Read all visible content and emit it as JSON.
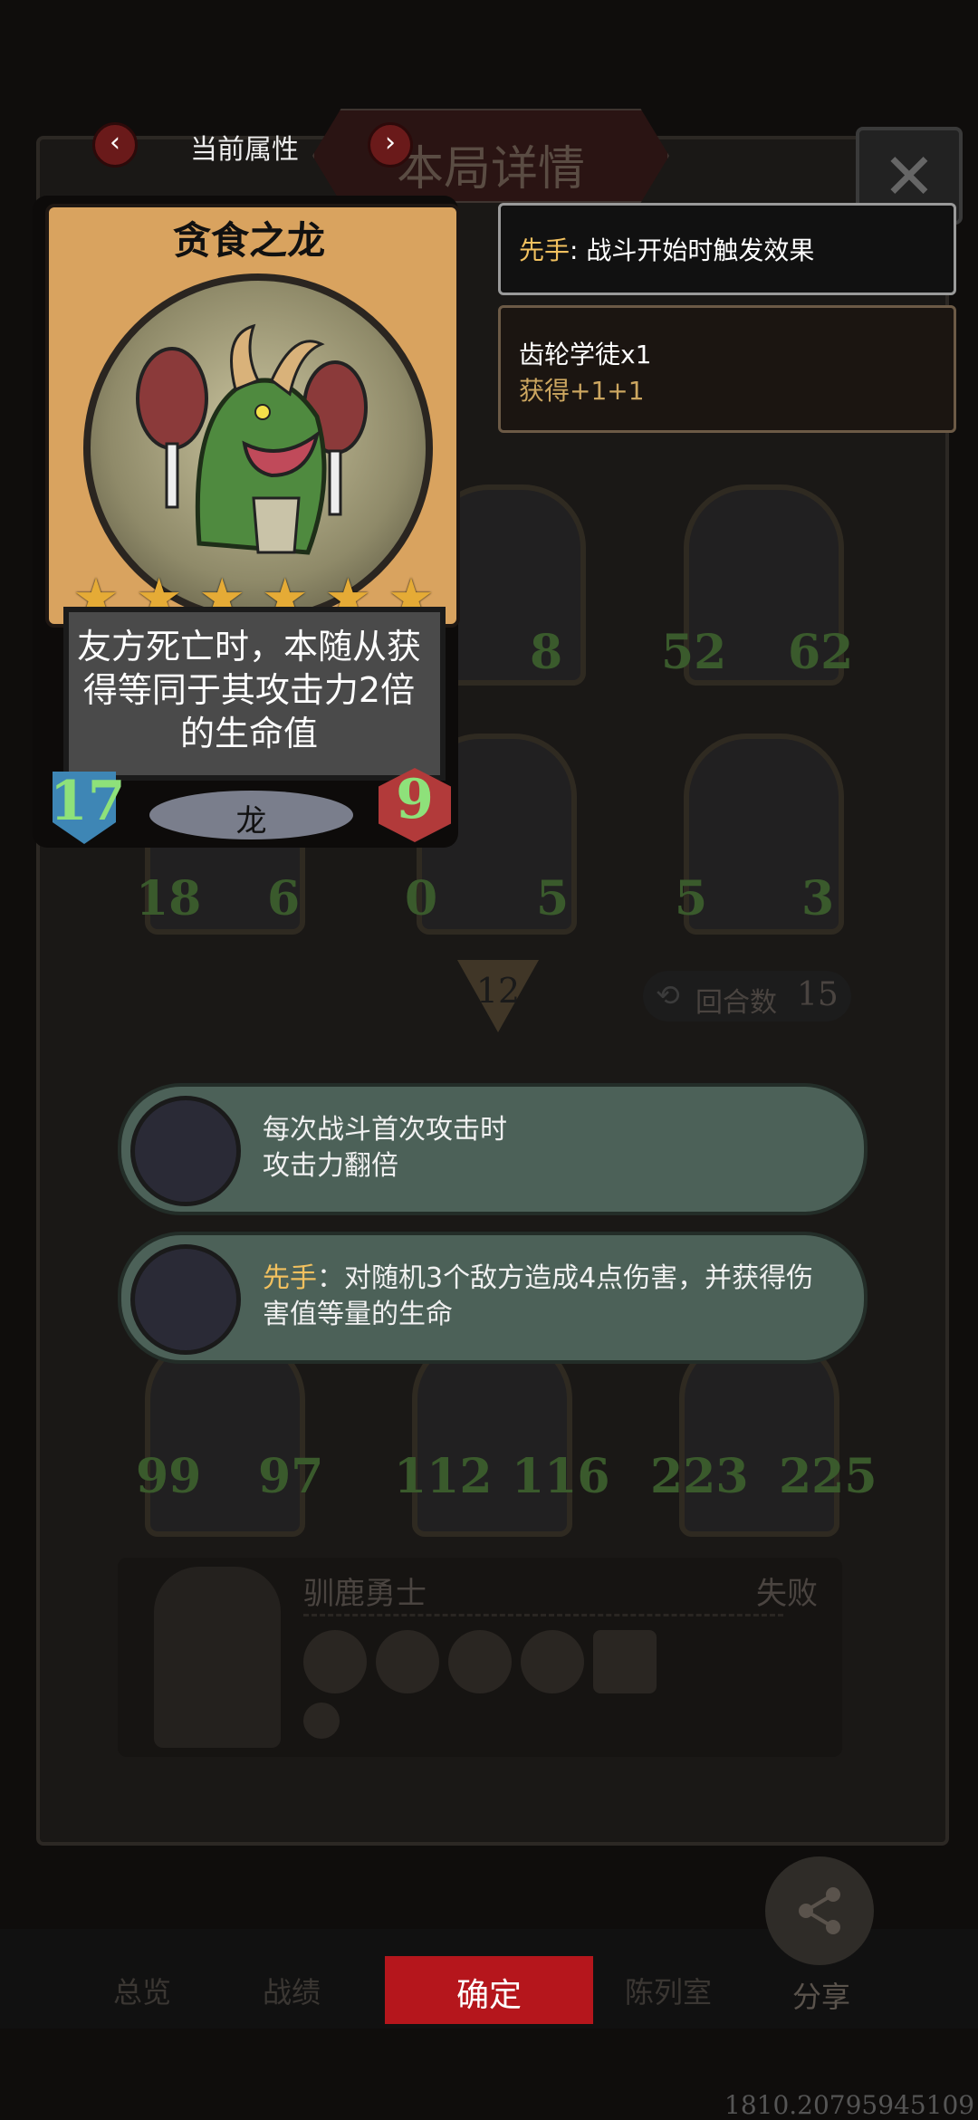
{
  "header": {
    "title": "本局详情",
    "current_attr_label": "当前属性",
    "prev_arrow": "‹",
    "next_arrow": "›",
    "close_icon": "✕"
  },
  "card": {
    "name": "贪食之龙",
    "stars": 6,
    "description": "友方死亡时，本随从获得等同于其攻击力2倍的生命值",
    "tribe": "龙",
    "attack": "17",
    "health": "9"
  },
  "info_boxes": [
    {
      "keyword": "先手",
      "text": ": 战斗开始时触发效果"
    },
    {
      "line1": "齿轮学徒x1",
      "line2": "获得+1+1"
    }
  ],
  "board": {
    "top_row": [
      {
        "atk": "",
        "hp": "8"
      },
      {
        "atk": "52",
        "hp": "62"
      }
    ],
    "mid_row": [
      {
        "atk": "18",
        "hp": "6"
      },
      {
        "atk": "0",
        "hp": "5"
      },
      {
        "atk": "5",
        "hp": "3"
      }
    ],
    "tier": "12",
    "rounds_label": "回合数",
    "rounds_value": "15",
    "bottom_row": [
      {
        "atk": "99",
        "hp": "97"
      },
      {
        "atk": "112",
        "hp": "116"
      },
      {
        "atk": "223",
        "hp": "225"
      }
    ],
    "opponent_name": "驯鹿勇士",
    "result": "失败"
  },
  "skills": [
    {
      "keyword": "",
      "text": "每次战斗首次攻击时\n攻击力翻倍"
    },
    {
      "keyword": "先手",
      "text": "：对随机3个敌方造成4点伤害，并获得伤害值等量的生命"
    }
  ],
  "bottom_nav": {
    "tabs": [
      "总览",
      "战绩",
      "陈列室"
    ],
    "confirm": "确定",
    "share": "分享"
  },
  "footer": {
    "id": "1810.20795945109"
  },
  "colors": {
    "accent": "#b5161c",
    "highlight": "#f2c15f",
    "skill_bg": "#4c6158"
  }
}
